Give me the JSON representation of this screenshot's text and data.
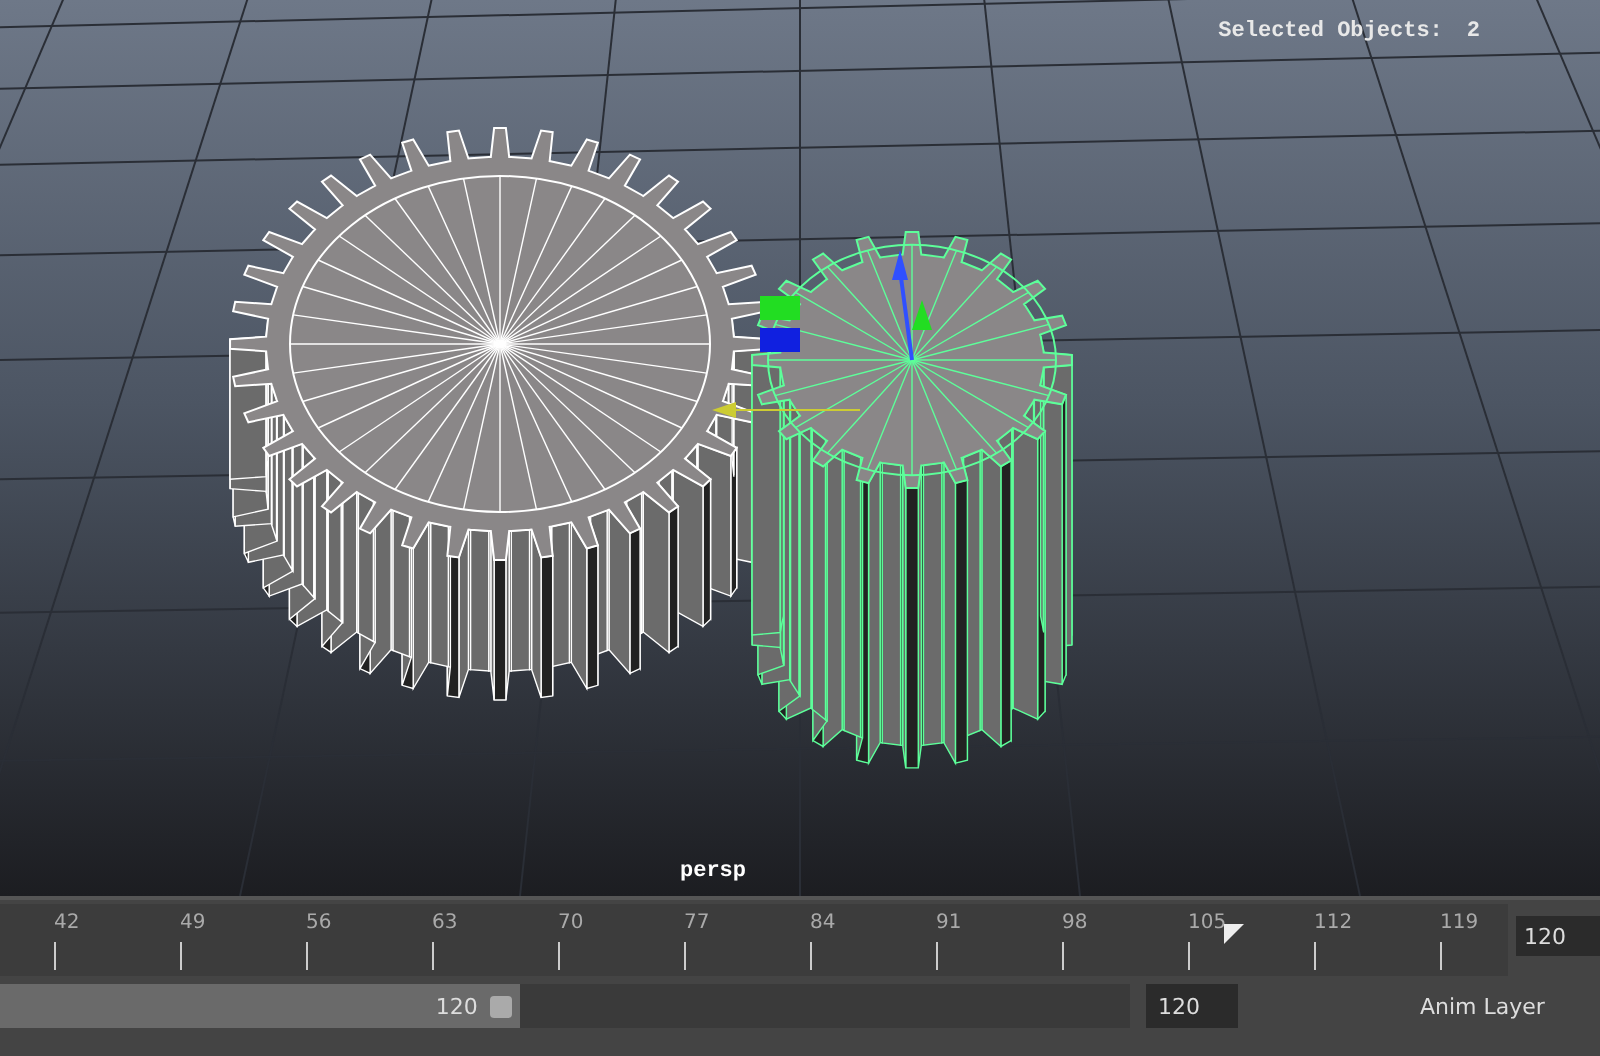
{
  "viewport": {
    "camera_label": "persp",
    "hud": [
      {
        "label": "Selected Objects:",
        "value": "2"
      }
    ],
    "objects": [
      {
        "selected": false
      },
      {
        "selected": true
      }
    ]
  },
  "time_slider": {
    "ticks": [
      "42",
      "49",
      "56",
      "63",
      "70",
      "77",
      "84",
      "91",
      "98",
      "105",
      "112",
      "119"
    ],
    "level": 0.81,
    "end_field": "120"
  },
  "range_slider": {
    "level": 0.46,
    "end_label": "120",
    "field": "120",
    "layer_label": "Anim Layer"
  }
}
